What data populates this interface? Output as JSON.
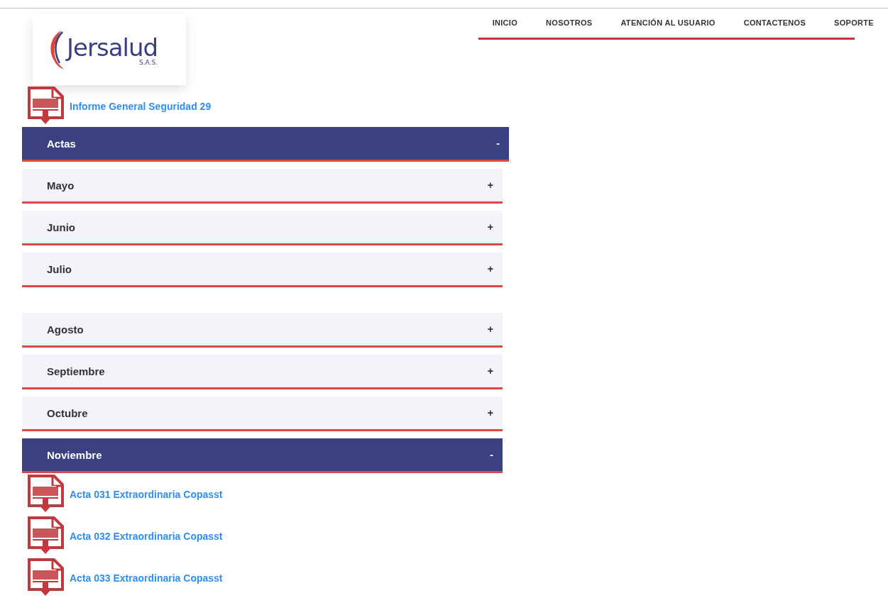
{
  "nav": [
    {
      "label": "INICIO"
    },
    {
      "label": "NOSOTROS"
    },
    {
      "label": "ATENCIÓN AL USUARIO"
    },
    {
      "label": "CONTACTENOS"
    },
    {
      "label": "SOPORTE"
    }
  ],
  "logo": {
    "name": "Jersalud",
    "suffix": "S.A.S."
  },
  "top_documents": [
    {
      "label": "Informe General Seguridad 29"
    }
  ],
  "sections": [
    {
      "title": "Actas",
      "expanded": true,
      "groups": [
        {
          "months": [
            {
              "title": "Mayo",
              "expanded": false
            },
            {
              "title": "Junio",
              "expanded": false
            },
            {
              "title": "Julio",
              "expanded": false
            }
          ]
        },
        {
          "months": [
            {
              "title": "Agosto",
              "expanded": false
            },
            {
              "title": "Septiembre",
              "expanded": false
            },
            {
              "title": "Octubre",
              "expanded": false
            },
            {
              "title": "Noviembre",
              "expanded": true,
              "documents": [
                {
                  "label": "Acta 031 Extraordinaria Copasst"
                },
                {
                  "label": "Acta 032 Extraordinaria Copasst"
                },
                {
                  "label": "Acta 033 Extraordinaria Copasst"
                }
              ]
            }
          ]
        }
      ]
    }
  ],
  "toggle_symbols": {
    "expanded": "-",
    "collapsed": "+"
  }
}
